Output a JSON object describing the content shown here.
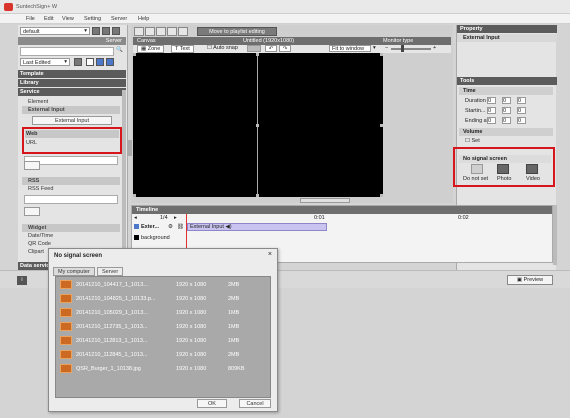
{
  "window": {
    "title": "SuntechSign+ W"
  },
  "menu": [
    "File",
    "Edit",
    "View",
    "Setting",
    "Server",
    "Help"
  ],
  "left": {
    "server_select": "default",
    "server_label": "Server",
    "sort_select": "Last Edited",
    "sections": {
      "template": "Template",
      "library": "Library",
      "service": "Service"
    },
    "element_label": "Element",
    "external_input": {
      "heading": "External Input",
      "button": "External Input"
    },
    "web": {
      "heading": "Web",
      "item": "URL"
    },
    "rss": {
      "heading": "RSS",
      "item": "RSS Feed"
    },
    "widget": {
      "heading": "Widget",
      "items": [
        "Date/Time",
        "QR Code",
        "Clipart"
      ]
    },
    "data_service": "Data service"
  },
  "toolbar": {
    "move_button": "Move to playlist editing"
  },
  "canvas": {
    "title": "Canvas",
    "name": "Untitled (1920x1080)",
    "monitor_type": "Monitor type",
    "zone_label": "Zone",
    "text_label": "Text",
    "auto_snap": "Auto snap",
    "fit_select": "Fit to window"
  },
  "property": {
    "title": "Property",
    "subtitle": "External Input"
  },
  "tools": {
    "title": "Tools",
    "time_label": "Time",
    "duration": "Duration",
    "starting": "Startin...",
    "ending": "Ending at",
    "zero": "0",
    "volume": "Volume",
    "set": "Set",
    "no_signal": "No signal screen",
    "options": [
      "Do not set",
      "Photo",
      "Video"
    ]
  },
  "timeline": {
    "title": "Timeline",
    "zoom": "1/4",
    "markers": [
      "0:01",
      "0:02"
    ],
    "tracks": [
      {
        "name": "Exter...",
        "clip": "External Input"
      },
      {
        "name": "background",
        "clip": ""
      }
    ],
    "preview_button": "Preview"
  },
  "dialog": {
    "title": "No signal screen",
    "tabs": [
      "My computer",
      "Server"
    ],
    "files": [
      {
        "name": "20141210_104417_1_1013...",
        "res": "1920 x 1080",
        "size": "2MB"
      },
      {
        "name": "20141210_104825_1_10133.p...",
        "res": "1920 x 1080",
        "size": "2MB"
      },
      {
        "name": "20141210_105029_1_1013...",
        "res": "1920 x 1080",
        "size": "1MB"
      },
      {
        "name": "20141210_112735_1_1013...",
        "res": "1920 x 1080",
        "size": "1MB"
      },
      {
        "name": "20141210_112813_1_1013...",
        "res": "1920 x 1080",
        "size": "1MB"
      },
      {
        "name": "20141210_112845_1_1013...",
        "res": "1920 x 1080",
        "size": "2MB"
      },
      {
        "name": "QSR_Burger_1_10138.jpg",
        "res": "1920 x 1080",
        "size": "809KB"
      }
    ],
    "ok": "OK",
    "cancel": "Cancel"
  },
  "colors": {
    "highlight": "#d6161d",
    "clip": "#c9c4ef"
  }
}
